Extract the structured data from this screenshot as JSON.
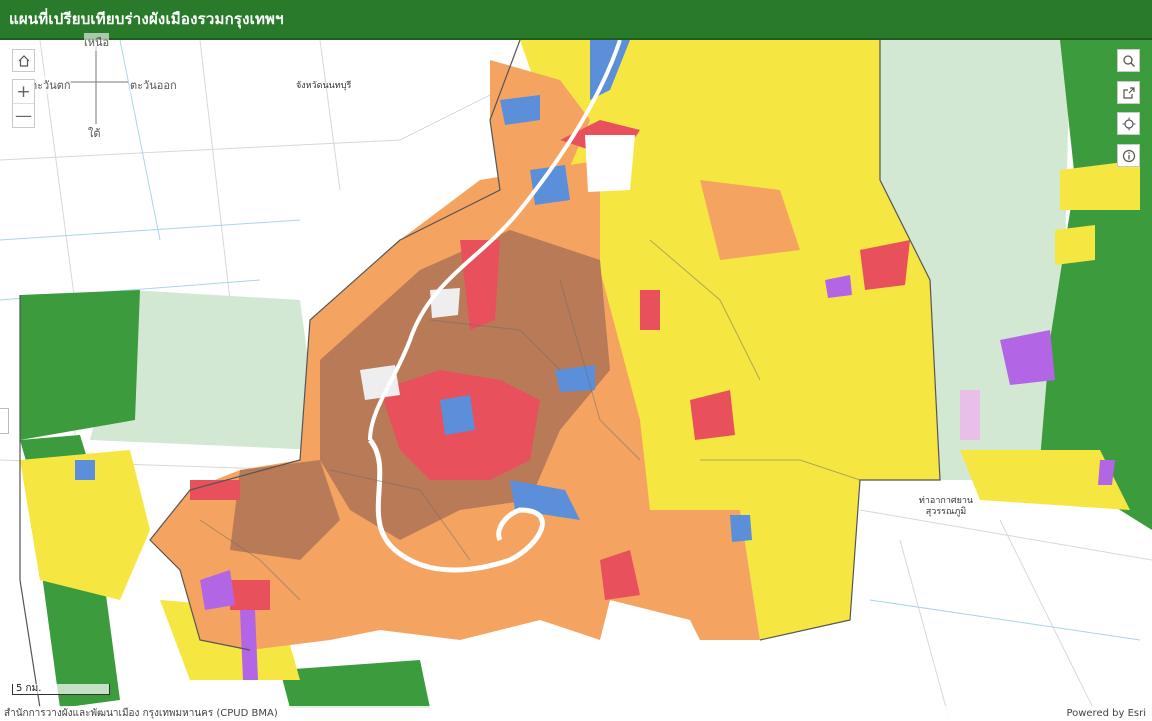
{
  "header": {
    "title": "แผนที่เปรียบเทียบร่างผังเมืองรวมกรุงเทพฯ"
  },
  "compass": {
    "north": "เหนือ",
    "west": "ตะวันตก",
    "east": "ตะวันออก",
    "south": "ใต้"
  },
  "places": {
    "nonthaburi": "จังหวัดนนทบุรี",
    "samut_prakan": "ท่าอากาศยานสุวรรณภูมิ"
  },
  "scale": {
    "label": "5 กม."
  },
  "attribution": {
    "source": "สำนักการวางผังและพัฒนาเมือง กรุงเทพมหานคร (CPUD BMA)",
    "powered": "Powered by Esri"
  },
  "icons": {
    "home": "home-icon",
    "zoom_in": "plus-icon",
    "zoom_out": "minus-icon",
    "search": "search-icon",
    "share": "share-icon",
    "locate": "locate-icon",
    "info": "info-icon"
  },
  "colors": {
    "header": "#2a7a2c",
    "high_density_commercial": "#e8505b",
    "medium_density_residential": "#f4a460",
    "high_density_residential": "#b97a57",
    "low_density_residential": "#f5e642",
    "agricultural_conservation": "#3c9b3c",
    "rural_agricultural": "#d3e8d3",
    "government": "#5b8fd9",
    "industrial": "#b266e6",
    "warehouse": "#e8bfe8"
  }
}
